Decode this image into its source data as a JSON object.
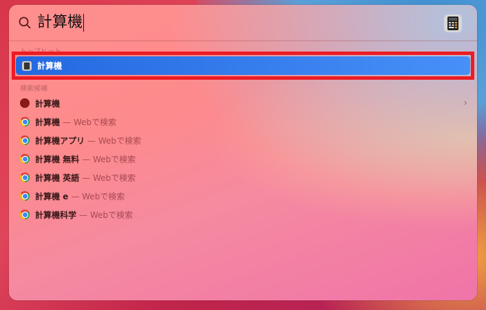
{
  "search": {
    "query": "計算機"
  },
  "sections": {
    "top_hit": "トップヒット",
    "suggestions": "検索候補"
  },
  "top_hit": {
    "label": "計算機"
  },
  "suggestions": [
    {
      "label": "計算機",
      "suffix": "",
      "icon": "search-icon"
    },
    {
      "label": "計算機",
      "suffix": "— Webで検索",
      "icon": "chrome-icon"
    },
    {
      "label": "計算機アプリ",
      "suffix": "— Webで検索",
      "icon": "chrome-icon"
    },
    {
      "label": "計算機 無料",
      "suffix": "— Webで検索",
      "icon": "chrome-icon"
    },
    {
      "label": "計算機 英語",
      "suffix": "— Webで検索",
      "icon": "chrome-icon"
    },
    {
      "label": "計算機 e",
      "suffix": "— Webで検索",
      "icon": "chrome-icon"
    },
    {
      "label": "計算機科学",
      "suffix": "— Webで検索",
      "icon": "chrome-icon"
    }
  ],
  "colors": {
    "highlight": "#2a70e8",
    "annotation": "#ec1c24"
  }
}
